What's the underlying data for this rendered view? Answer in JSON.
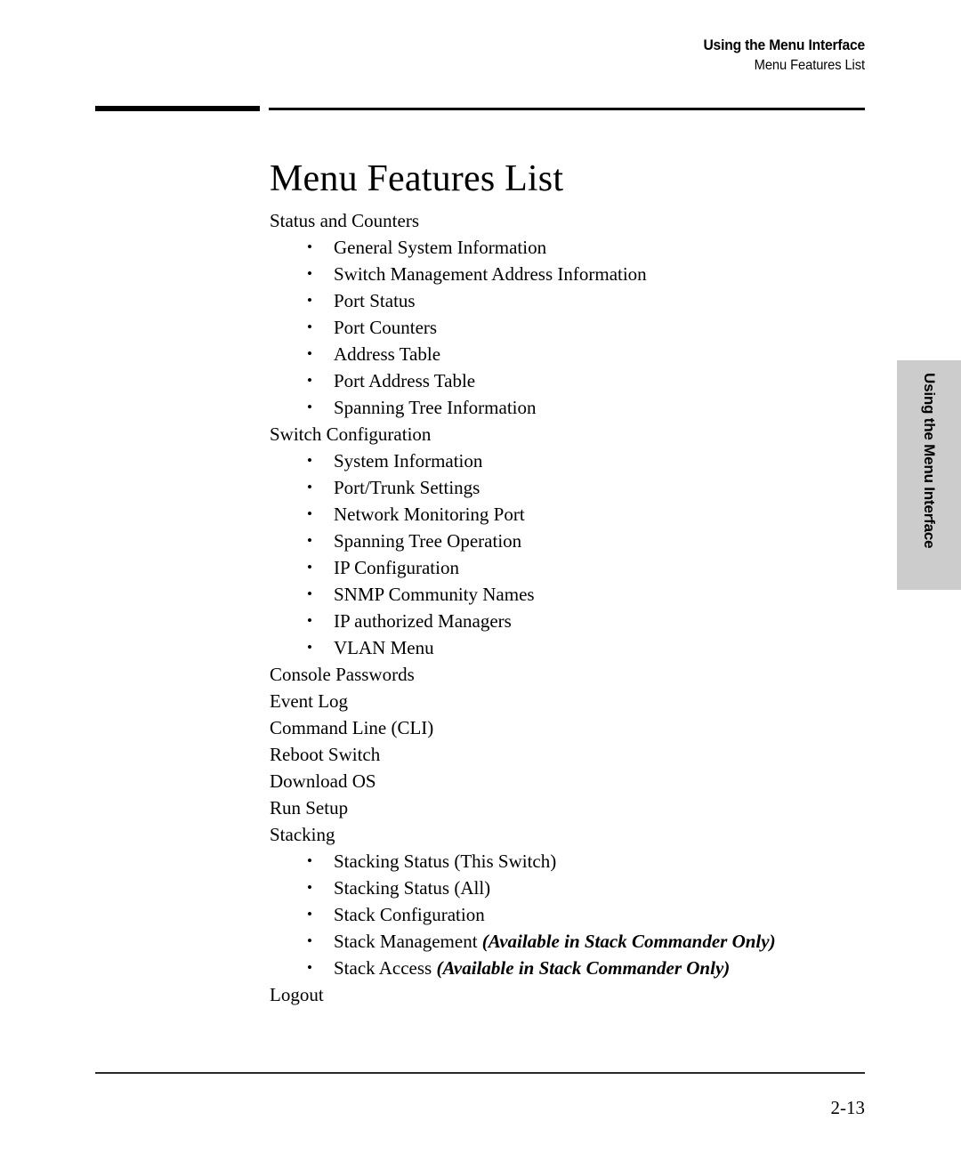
{
  "header": {
    "line1": "Using the Menu Interface",
    "line2": "Menu Features List"
  },
  "title": "Menu Features List",
  "side_tab": {
    "label": "Using the Menu Interface",
    "background_color": "#cccccc"
  },
  "footer": {
    "page_number": "2-13"
  },
  "note_text": "(Available in Stack Commander Only)",
  "list": [
    {
      "level": 1,
      "text": "Status and Counters"
    },
    {
      "level": 2,
      "text": "General System Information"
    },
    {
      "level": 2,
      "text": "Switch Management Address Information"
    },
    {
      "level": 2,
      "text": "Port Status"
    },
    {
      "level": 2,
      "text": "Port Counters"
    },
    {
      "level": 2,
      "text": "Address Table"
    },
    {
      "level": 2,
      "text": "Port Address Table"
    },
    {
      "level": 2,
      "text": "Spanning Tree Information"
    },
    {
      "level": 1,
      "text": "Switch Configuration"
    },
    {
      "level": 2,
      "text": "System Information"
    },
    {
      "level": 2,
      "text": "Port/Trunk Settings"
    },
    {
      "level": 2,
      "text": "Network Monitoring Port"
    },
    {
      "level": 2,
      "text": "Spanning Tree Operation"
    },
    {
      "level": 2,
      "text": "IP Configuration"
    },
    {
      "level": 2,
      "text": "SNMP Community Names"
    },
    {
      "level": 2,
      "text": "IP authorized Managers"
    },
    {
      "level": 2,
      "text": "VLAN Menu"
    },
    {
      "level": 1,
      "text": "Console Passwords"
    },
    {
      "level": 1,
      "text": "Event Log"
    },
    {
      "level": 1,
      "text": "Command Line (CLI)"
    },
    {
      "level": 1,
      "text": "Reboot Switch"
    },
    {
      "level": 1,
      "text": "Download OS"
    },
    {
      "level": 1,
      "text": "Run Setup"
    },
    {
      "level": 1,
      "text": "Stacking"
    },
    {
      "level": 2,
      "text": "Stacking Status (This Switch)"
    },
    {
      "level": 2,
      "text": "Stacking Status (All)"
    },
    {
      "level": 2,
      "text": "Stack Configuration"
    },
    {
      "level": 2,
      "text": "Stack Management",
      "note": "(Available in Stack Commander Only)"
    },
    {
      "level": 2,
      "text": "Stack Access",
      "note": "(Available in Stack Commander Only)"
    },
    {
      "level": 1,
      "text": "Logout"
    }
  ],
  "bullet_glyph": "•"
}
